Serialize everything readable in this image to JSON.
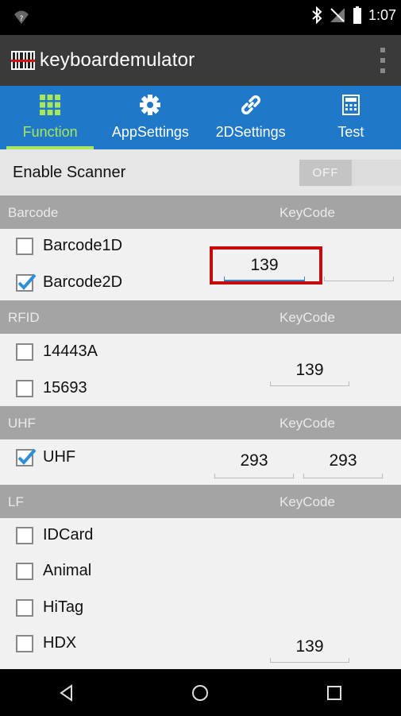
{
  "status_bar": {
    "time": "1:07"
  },
  "app": {
    "title": "keyboardemulator"
  },
  "tabs": [
    {
      "label": "Function",
      "icon": "grid-icon",
      "active": true
    },
    {
      "label": "AppSettings",
      "icon": "gear-icon",
      "active": false
    },
    {
      "label": "2DSettings",
      "icon": "link-icon",
      "active": false
    },
    {
      "label": "Test",
      "icon": "calculator-icon",
      "active": false
    }
  ],
  "enable_scanner": {
    "label": "Enable Scanner",
    "toggle_text": "OFF"
  },
  "barcode": {
    "header": "Barcode",
    "keycode_label": "KeyCode",
    "items": [
      {
        "label": "Barcode1D",
        "checked": false
      },
      {
        "label": "Barcode2D",
        "checked": true
      }
    ],
    "keycode": "139"
  },
  "rfid": {
    "header": "RFID",
    "keycode_label": "KeyCode",
    "items": [
      {
        "label": "14443A",
        "checked": false
      },
      {
        "label": "15693",
        "checked": false
      }
    ],
    "keycode": "139"
  },
  "uhf": {
    "header": "UHF",
    "keycode_label": "KeyCode",
    "items": [
      {
        "label": "UHF",
        "checked": true
      }
    ],
    "keycode_1": "293",
    "keycode_2": "293"
  },
  "lf": {
    "header": "LF",
    "keycode_label": "KeyCode",
    "items": [
      {
        "label": "IDCard",
        "checked": false
      },
      {
        "label": "Animal",
        "checked": false
      },
      {
        "label": "HiTag",
        "checked": false
      },
      {
        "label": "HDX",
        "checked": false
      }
    ],
    "keycode": "139"
  },
  "colors": {
    "tab_bar": "#1f79c8",
    "active_tab": "#a8e65b",
    "section_header": "#a4a4a4",
    "highlight": "#c40c0c",
    "check": "#2d8fd8"
  }
}
